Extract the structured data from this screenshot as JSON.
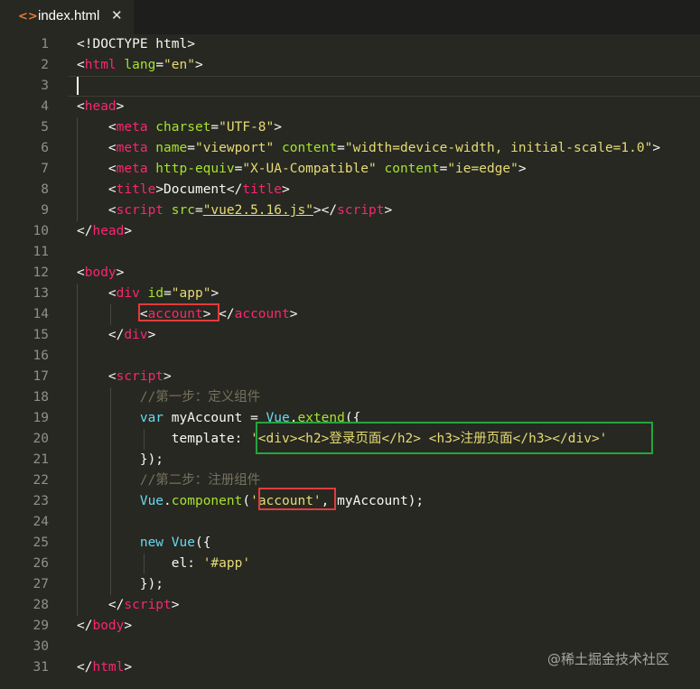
{
  "tab": {
    "icon": "<>",
    "label": "index.html",
    "close": "✕"
  },
  "lines": [
    {
      "n": "1",
      "tokens": [
        {
          "t": "<!DOCTYPE html>",
          "c": "p"
        }
      ]
    },
    {
      "n": "2",
      "tokens": [
        {
          "t": "<",
          "c": "p"
        },
        {
          "t": "html",
          "c": "t"
        },
        {
          "t": " lang",
          "c": "a"
        },
        {
          "t": "=",
          "c": "p"
        },
        {
          "t": "\"en\"",
          "c": "s"
        },
        {
          "t": ">",
          "c": "p"
        }
      ]
    },
    {
      "n": "3",
      "tokens": []
    },
    {
      "n": "4",
      "tokens": [
        {
          "t": "<",
          "c": "p"
        },
        {
          "t": "head",
          "c": "t"
        },
        {
          "t": ">",
          "c": "p"
        }
      ]
    },
    {
      "n": "5",
      "tokens": [
        {
          "t": "    <",
          "c": "p"
        },
        {
          "t": "meta",
          "c": "t"
        },
        {
          "t": " charset",
          "c": "a"
        },
        {
          "t": "=",
          "c": "p"
        },
        {
          "t": "\"UTF-8\"",
          "c": "s"
        },
        {
          "t": ">",
          "c": "p"
        }
      ]
    },
    {
      "n": "6",
      "tokens": [
        {
          "t": "    <",
          "c": "p"
        },
        {
          "t": "meta",
          "c": "t"
        },
        {
          "t": " name",
          "c": "a"
        },
        {
          "t": "=",
          "c": "p"
        },
        {
          "t": "\"viewport\"",
          "c": "s"
        },
        {
          "t": " content",
          "c": "a"
        },
        {
          "t": "=",
          "c": "p"
        },
        {
          "t": "\"width=device-width, initial-scale=1.0\"",
          "c": "s"
        },
        {
          "t": ">",
          "c": "p"
        }
      ]
    },
    {
      "n": "7",
      "tokens": [
        {
          "t": "    <",
          "c": "p"
        },
        {
          "t": "meta",
          "c": "t"
        },
        {
          "t": " http-equiv",
          "c": "a"
        },
        {
          "t": "=",
          "c": "p"
        },
        {
          "t": "\"X-UA-Compatible\"",
          "c": "s"
        },
        {
          "t": " content",
          "c": "a"
        },
        {
          "t": "=",
          "c": "p"
        },
        {
          "t": "\"ie=edge\"",
          "c": "s"
        },
        {
          "t": ">",
          "c": "p"
        }
      ]
    },
    {
      "n": "8",
      "tokens": [
        {
          "t": "    <",
          "c": "p"
        },
        {
          "t": "title",
          "c": "t"
        },
        {
          "t": ">Document</",
          "c": "p"
        },
        {
          "t": "title",
          "c": "t"
        },
        {
          "t": ">",
          "c": "p"
        }
      ]
    },
    {
      "n": "9",
      "tokens": [
        {
          "t": "    <",
          "c": "p"
        },
        {
          "t": "script",
          "c": "t"
        },
        {
          "t": " src",
          "c": "a"
        },
        {
          "t": "=",
          "c": "p"
        },
        {
          "t": "\"vue2.5.16.js\"",
          "c": "s u"
        },
        {
          "t": "></",
          "c": "p"
        },
        {
          "t": "script",
          "c": "t"
        },
        {
          "t": ">",
          "c": "p"
        }
      ]
    },
    {
      "n": "10",
      "tokens": [
        {
          "t": "</",
          "c": "p"
        },
        {
          "t": "head",
          "c": "t"
        },
        {
          "t": ">",
          "c": "p"
        }
      ]
    },
    {
      "n": "11",
      "tokens": []
    },
    {
      "n": "12",
      "tokens": [
        {
          "t": "<",
          "c": "p"
        },
        {
          "t": "body",
          "c": "t"
        },
        {
          "t": ">",
          "c": "p"
        }
      ]
    },
    {
      "n": "13",
      "tokens": [
        {
          "t": "    <",
          "c": "p"
        },
        {
          "t": "div",
          "c": "t"
        },
        {
          "t": " id",
          "c": "a"
        },
        {
          "t": "=",
          "c": "p"
        },
        {
          "t": "\"app\"",
          "c": "s"
        },
        {
          "t": ">",
          "c": "p"
        }
      ]
    },
    {
      "n": "14",
      "tokens": [
        {
          "t": "        <",
          "c": "p"
        },
        {
          "t": "account",
          "c": "t"
        },
        {
          "t": "> </",
          "c": "p"
        },
        {
          "t": "account",
          "c": "t"
        },
        {
          "t": ">",
          "c": "p"
        }
      ]
    },
    {
      "n": "15",
      "tokens": [
        {
          "t": "    </",
          "c": "p"
        },
        {
          "t": "div",
          "c": "t"
        },
        {
          "t": ">",
          "c": "p"
        }
      ]
    },
    {
      "n": "16",
      "tokens": []
    },
    {
      "n": "17",
      "tokens": [
        {
          "t": "    <",
          "c": "p"
        },
        {
          "t": "script",
          "c": "t"
        },
        {
          "t": ">",
          "c": "p"
        }
      ]
    },
    {
      "n": "18",
      "tokens": [
        {
          "t": "        //第一步：定义组件",
          "c": "c"
        }
      ]
    },
    {
      "n": "19",
      "tokens": [
        {
          "t": "        ",
          "c": "p"
        },
        {
          "t": "var",
          "c": "k"
        },
        {
          "t": " myAccount = ",
          "c": "p"
        },
        {
          "t": "Vue",
          "c": "k"
        },
        {
          "t": ".",
          "c": "p"
        },
        {
          "t": "extend",
          "c": "a"
        },
        {
          "t": "({",
          "c": "p"
        }
      ]
    },
    {
      "n": "20",
      "tokens": [
        {
          "t": "            template: ",
          "c": "p"
        },
        {
          "t": "'<div><h2>登录页面</h2> <h3>注册页面</h3></div>'",
          "c": "s"
        }
      ]
    },
    {
      "n": "21",
      "tokens": [
        {
          "t": "        });",
          "c": "p"
        }
      ]
    },
    {
      "n": "22",
      "tokens": [
        {
          "t": "        //第二步：注册组件",
          "c": "c"
        }
      ]
    },
    {
      "n": "23",
      "tokens": [
        {
          "t": "        ",
          "c": "p"
        },
        {
          "t": "Vue",
          "c": "k"
        },
        {
          "t": ".",
          "c": "p"
        },
        {
          "t": "component",
          "c": "a"
        },
        {
          "t": "(",
          "c": "p"
        },
        {
          "t": "'account'",
          "c": "s"
        },
        {
          "t": ", myAccount);",
          "c": "p"
        }
      ]
    },
    {
      "n": "24",
      "tokens": []
    },
    {
      "n": "25",
      "tokens": [
        {
          "t": "        ",
          "c": "p"
        },
        {
          "t": "new",
          "c": "k"
        },
        {
          "t": " ",
          "c": "p"
        },
        {
          "t": "Vue",
          "c": "k"
        },
        {
          "t": "({",
          "c": "p"
        }
      ]
    },
    {
      "n": "26",
      "tokens": [
        {
          "t": "            el: ",
          "c": "p"
        },
        {
          "t": "'#app'",
          "c": "s"
        }
      ]
    },
    {
      "n": "27",
      "tokens": [
        {
          "t": "        });",
          "c": "p"
        }
      ]
    },
    {
      "n": "28",
      "tokens": [
        {
          "t": "    </",
          "c": "p"
        },
        {
          "t": "script",
          "c": "t"
        },
        {
          "t": ">",
          "c": "p"
        }
      ]
    },
    {
      "n": "29",
      "tokens": [
        {
          "t": "</",
          "c": "p"
        },
        {
          "t": "body",
          "c": "t"
        },
        {
          "t": ">",
          "c": "p"
        }
      ]
    },
    {
      "n": "30",
      "tokens": []
    },
    {
      "n": "31",
      "tokens": [
        {
          "t": "</",
          "c": "p"
        },
        {
          "t": "html",
          "c": "t"
        },
        {
          "t": ">",
          "c": "p"
        }
      ]
    }
  ],
  "watermark": "@稀土掘金技术社区",
  "colors": {
    "background": "#272822",
    "tag": "#f92672",
    "attribute": "#a6e22e",
    "string": "#e6db74",
    "comment": "#75715e",
    "keyword": "#66d9ef",
    "highlight_red": "#e23b3b",
    "highlight_green": "#25a53d"
  }
}
